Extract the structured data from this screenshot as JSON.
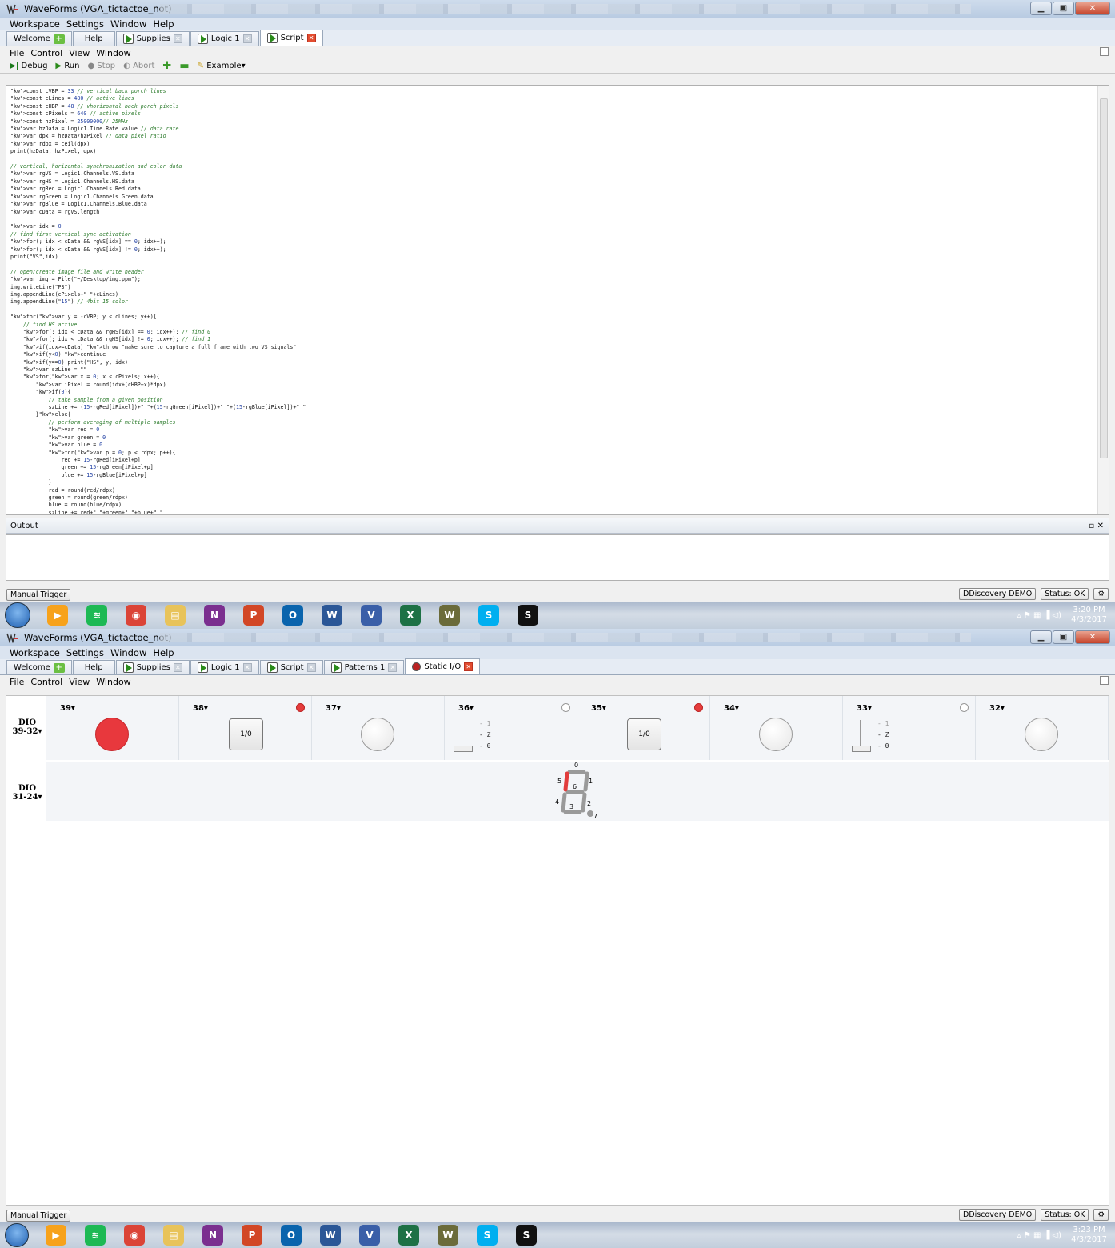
{
  "window": {
    "title": "WaveForms  (VGA_tictactoe_not)",
    "menu": [
      "Workspace",
      "Settings",
      "Window",
      "Help"
    ]
  },
  "screen1": {
    "tabs": [
      {
        "label": "Welcome",
        "icon": "plus-icon"
      },
      {
        "label": "Help"
      },
      {
        "label": "Supplies",
        "icon": "play-icon"
      },
      {
        "label": "Logic 1",
        "icon": "play-icon"
      },
      {
        "label": "Script",
        "icon": "play-icon",
        "active": true
      }
    ],
    "submenu": [
      "File",
      "Control",
      "View",
      "Window"
    ],
    "toolbar": {
      "debug": "Debug",
      "run": "Run",
      "stop": "Stop",
      "abort": "Abort",
      "example": "Example"
    },
    "code": [
      "const cVBP = 33 // vertical back porch lines",
      "const cLines = 480 // active lines",
      "const cHBP = 48 // vhorizontal back porch pixels",
      "const cPixels = 640 // active pixels",
      "const hzPixel = 25000000// 25MHz",
      "var hzData = Logic1.Time.Rate.value // data rate",
      "var dpx = hzData/hzPixel // data pixel ratio",
      "var rdpx = ceil(dpx)",
      "print(hzData, hzPixel, dpx)",
      "",
      "// vertical, horizontal synchronization and color data",
      "var rgVS = Logic1.Channels.VS.data",
      "var rgHS = Logic1.Channels.HS.data",
      "var rgRed = Logic1.Channels.Red.data",
      "var rgGreen = Logic1.Channels.Green.data",
      "var rgBlue = Logic1.Channels.Blue.data",
      "var cData = rgVS.length",
      "",
      "var idx = 0",
      "// find first vertical sync activation",
      "for(; idx < cData && rgVS[idx] == 0; idx++);",
      "for(; idx < cData && rgVS[idx] != 0; idx++);",
      "print(\"VS\",idx)",
      "",
      "// open/create image file and write header",
      "var img = File(\"~/Desktop/img.ppm\");",
      "img.writeLine(\"P3\")",
      "img.appendLine(cPixels+\" \"+cLines)",
      "img.appendLine(\"15\") // 4bit 15 color",
      "",
      "for(var y = -cVBP; y < cLines; y++){",
      "    // find HS active",
      "    for(; idx < cData && rgHS[idx] == 0; idx++); // find 0",
      "    for(; idx < cData && rgHS[idx] != 0; idx++); // find 1",
      "    if(idx>=cData) throw \"make sure to capture a full frame with two VS signals\"",
      "    if(y<0) continue",
      "    if(y==0) print(\"HS\", y, idx)",
      "    var szLine = \"\"",
      "    for(var x = 0; x < cPixels; x++){",
      "        var iPixel = round(idx+(cHBP+x)*dpx)",
      "        if(0){",
      "            // take sample from a given position",
      "            szLine += (15-rgRed[iPixel])+\" \"+(15-rgGreen[iPixel])+\" \"+(15-rgBlue[iPixel])+\" \"",
      "        }else{",
      "            // perform averaging of multiple samples",
      "            var red = 0",
      "            var green = 0",
      "            var blue = 0",
      "            for(var p = 0; p < rdpx; p++){",
      "                red += 15-rgRed[iPixel+p]",
      "                green += 15-rgGreen[iPixel+p]",
      "                blue += 15-rgBlue[iPixel+p]",
      "            }",
      "            red = round(red/rdpx)",
      "            green = round(green/rdpx)",
      "            blue = round(blue/rdpx)",
      "            szLine += red+\" \"+green+\" \"+blue+\" \""
    ],
    "output_label": "Output",
    "manual_trigger": "Manual Trigger",
    "device": "DDiscovery DEMO",
    "status": "Status: OK",
    "clock_time": "3:20 PM",
    "clock_date": "4/3/2017"
  },
  "screen2": {
    "tabs": [
      {
        "label": "Welcome",
        "icon": "plus-icon"
      },
      {
        "label": "Help"
      },
      {
        "label": "Supplies",
        "icon": "play-icon"
      },
      {
        "label": "Logic 1",
        "icon": "play-icon"
      },
      {
        "label": "Script",
        "icon": "play-icon"
      },
      {
        "label": "Patterns 1",
        "icon": "play-icon"
      },
      {
        "label": "Static I/O",
        "icon": "record-icon",
        "active": true
      }
    ],
    "submenu": [
      "File",
      "Control",
      "View",
      "Window"
    ],
    "row1_label": [
      "DIO",
      "39-32"
    ],
    "row2_label": [
      "DIO",
      "31-24"
    ],
    "pins": [
      {
        "label": "39",
        "widget": "led",
        "on": true
      },
      {
        "label": "38",
        "widget": "button",
        "text": "1/0",
        "state_on": true
      },
      {
        "label": "37",
        "widget": "led",
        "on": false
      },
      {
        "label": "36",
        "widget": "switch",
        "state_on": false,
        "levels": [
          "1",
          "Z",
          "0"
        ]
      },
      {
        "label": "35",
        "widget": "button",
        "text": "1/0",
        "state_on": true
      },
      {
        "label": "34",
        "widget": "led",
        "on": false
      },
      {
        "label": "33",
        "widget": "switch",
        "state_on": false,
        "levels": [
          "1",
          "Z",
          "0"
        ]
      },
      {
        "label": "32",
        "widget": "led",
        "on": false
      }
    ],
    "seven_seg": {
      "labels": [
        "0",
        "1",
        "2",
        "3",
        "4",
        "5",
        "6",
        "7"
      ],
      "lit_segment": "5"
    },
    "manual_trigger": "Manual Trigger",
    "device": "DDiscovery DEMO",
    "status": "Status: OK",
    "clock_time": "3:23 PM",
    "clock_date": "4/3/2017"
  },
  "taskbar_apps": [
    {
      "name": "media-player-icon",
      "color": "#f7a21b",
      "glyph": "▶"
    },
    {
      "name": "spotify-icon",
      "color": "#1db954",
      "glyph": "≋"
    },
    {
      "name": "chrome-icon",
      "color": "#db4437",
      "glyph": "◉"
    },
    {
      "name": "explorer-icon",
      "color": "#e8c35a",
      "glyph": "▤"
    },
    {
      "name": "onenote-icon",
      "color": "#7b2f8f",
      "glyph": "N"
    },
    {
      "name": "powerpoint-icon",
      "color": "#d24726",
      "glyph": "P"
    },
    {
      "name": "outlook-icon",
      "color": "#0a64ad",
      "glyph": "O"
    },
    {
      "name": "word-icon",
      "color": "#2b5797",
      "glyph": "W"
    },
    {
      "name": "visio-icon",
      "color": "#3a5fa8",
      "glyph": "V"
    },
    {
      "name": "excel-icon",
      "color": "#1e7145",
      "glyph": "X"
    },
    {
      "name": "waveforms-icon",
      "color": "#6b6b3a",
      "glyph": "W"
    },
    {
      "name": "skype-icon",
      "color": "#00aff0",
      "glyph": "S"
    },
    {
      "name": "app-green-s-icon",
      "color": "#111",
      "glyph": "S"
    }
  ]
}
